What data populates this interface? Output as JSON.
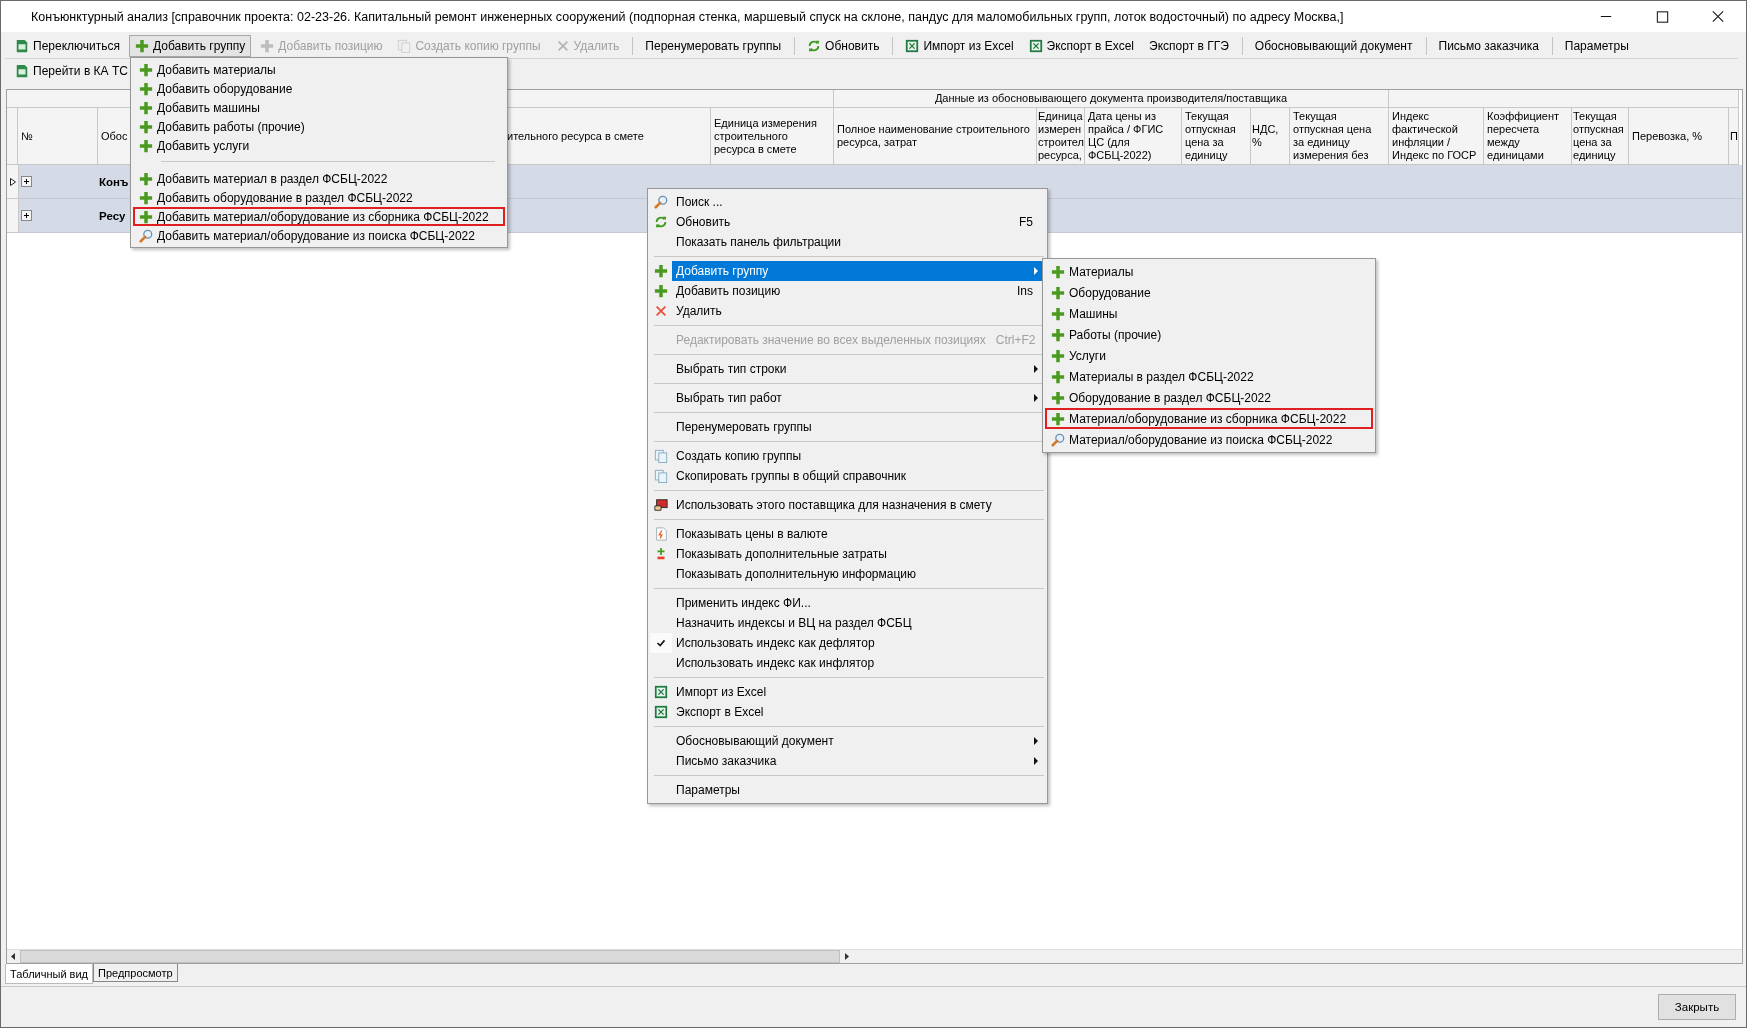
{
  "window": {
    "title": "Конъюнктурный анализ [справочник проекта: 02-23-26. Капитальный ремонт инженерных сооружений (подпорная стенка, маршевый спуск на склоне, пандус для маломобильных групп, лоток водосточный) по адресу Москва,]"
  },
  "toolbar": [
    {
      "kind": "button",
      "label": "Переключиться",
      "disabled": false,
      "pressed": false
    },
    {
      "kind": "button",
      "label": "Добавить группу",
      "disabled": false,
      "pressed": true
    },
    {
      "kind": "button",
      "label": "Добавить позицию",
      "disabled": true,
      "pressed": false
    },
    {
      "kind": "button",
      "label": "Создать копию группы",
      "disabled": true,
      "pressed": false
    },
    {
      "kind": "button",
      "label": "Удалить",
      "disabled": true,
      "pressed": false
    },
    {
      "kind": "separator"
    },
    {
      "kind": "button",
      "label": "Перенумеровать группы",
      "disabled": false,
      "pressed": false
    },
    {
      "kind": "separator"
    },
    {
      "kind": "button",
      "label": "Обновить",
      "disabled": false,
      "pressed": false
    },
    {
      "kind": "separator"
    },
    {
      "kind": "button",
      "label": "Импорт из Excel",
      "disabled": false,
      "pressed": false
    },
    {
      "kind": "button",
      "label": "Экспорт в Excel",
      "disabled": false,
      "pressed": false
    },
    {
      "kind": "button",
      "label": "Экспорт в ГГЭ",
      "disabled": false,
      "pressed": false
    },
    {
      "kind": "separator"
    },
    {
      "kind": "button",
      "label": "Обосновывающий документ",
      "disabled": false,
      "pressed": false
    },
    {
      "kind": "separator"
    },
    {
      "kind": "button",
      "label": "Письмо заказчика",
      "disabled": false,
      "pressed": false
    },
    {
      "kind": "separator"
    },
    {
      "kind": "button",
      "label": "Параметры",
      "disabled": false,
      "pressed": false
    }
  ],
  "toolbar_2": [
    {
      "label": "Перейти в КА ТС"
    }
  ],
  "table": {
    "group_header": "Данные из обосновывающего документа производителя/поставщика",
    "columns": [
      {
        "label": "№"
      },
      {
        "label": "Обос"
      },
      {
        "label": "ительного ресурса в смете"
      },
      {
        "label": "Единица измерения строительного ресурса в смете"
      },
      {
        "label": "Полное наименование строительного ресурса, затрат"
      },
      {
        "label": "Единица измерен строител ресурса,"
      },
      {
        "label": "Дата цены из прайса / ФГИС ЦС (для ФСБЦ-2022)"
      },
      {
        "label": "Текущая отпускная цена за единицу"
      },
      {
        "label": "НДС, %"
      },
      {
        "label": "Текущая отпускная цена за единицу измерения без"
      },
      {
        "label": "Индекс фактической инфляции / Индекс по  ГОСР"
      },
      {
        "label": "Коэффициент пересчета между единицами"
      },
      {
        "label": "Текущая отпускная цена за единицу"
      },
      {
        "label": "Перевозка, %"
      },
      {
        "label": "П"
      }
    ],
    "rows": [
      {
        "label": "Конъ",
        "selected": true
      },
      {
        "label": "Ресу",
        "selected": false
      }
    ]
  },
  "dropdown": {
    "items": [
      {
        "kind": "item",
        "label": "Добавить материалы",
        "highlighted": false
      },
      {
        "kind": "item",
        "label": "Добавить оборудование",
        "highlighted": false
      },
      {
        "kind": "item",
        "label": "Добавить машины",
        "highlighted": false
      },
      {
        "kind": "item",
        "label": "Добавить работы (прочие)",
        "highlighted": false
      },
      {
        "kind": "item",
        "label": "Добавить услуги",
        "highlighted": false
      },
      {
        "kind": "separator"
      },
      {
        "kind": "item",
        "label": "Добавить материал в раздел ФСБЦ-2022",
        "highlighted": false
      },
      {
        "kind": "item",
        "label": "Добавить оборудование в раздел ФСБЦ-2022",
        "highlighted": false
      },
      {
        "kind": "item",
        "label": "Добавить материал/оборудование из сборника ФСБЦ-2022",
        "highlighted": true
      },
      {
        "kind": "item",
        "label": "Добавить материал/оборудование из поиска ФСБЦ-2022",
        "highlighted": false
      }
    ]
  },
  "context_menu": {
    "items": [
      {
        "kind": "item",
        "label": "Поиск ...",
        "selected": false,
        "disabled": false,
        "checked": false,
        "submenu": false
      },
      {
        "kind": "item",
        "label": "Обновить",
        "shortcut": "F5",
        "selected": false,
        "disabled": false,
        "checked": false,
        "submenu": false
      },
      {
        "kind": "item",
        "label": "Показать панель фильтрации",
        "selected": false,
        "disabled": false,
        "checked": false,
        "submenu": false
      },
      {
        "kind": "separator"
      },
      {
        "kind": "item",
        "label": "Добавить группу",
        "selected": true,
        "disabled": false,
        "checked": false,
        "submenu": true
      },
      {
        "kind": "item",
        "label": "Добавить позицию",
        "shortcut": "Ins",
        "selected": false,
        "disabled": false,
        "checked": false,
        "submenu": false
      },
      {
        "kind": "item",
        "label": "Удалить",
        "selected": false,
        "disabled": false,
        "checked": false,
        "submenu": false
      },
      {
        "kind": "separator"
      },
      {
        "kind": "item",
        "label": "Редактировать значение во всех выделенных позициях",
        "shortcut": "Ctrl+F2",
        "selected": false,
        "disabled": true,
        "checked": false,
        "submenu": false
      },
      {
        "kind": "separator"
      },
      {
        "kind": "item",
        "label": "Выбрать тип строки",
        "selected": false,
        "disabled": false,
        "checked": false,
        "submenu": true
      },
      {
        "kind": "separator"
      },
      {
        "kind": "item",
        "label": "Выбрать тип работ",
        "selected": false,
        "disabled": false,
        "checked": false,
        "submenu": true
      },
      {
        "kind": "separator"
      },
      {
        "kind": "item",
        "label": "Перенумеровать группы",
        "selected": false,
        "disabled": false,
        "checked": false,
        "submenu": false
      },
      {
        "kind": "separator"
      },
      {
        "kind": "item",
        "label": "Создать копию группы",
        "selected": false,
        "disabled": false,
        "checked": false,
        "submenu": false
      },
      {
        "kind": "item",
        "label": "Скопировать группы в общий справочник",
        "selected": false,
        "disabled": false,
        "checked": false,
        "submenu": false
      },
      {
        "kind": "separator"
      },
      {
        "kind": "item",
        "label": "Использовать этого поставщика для назначения в смету",
        "selected": false,
        "disabled": false,
        "checked": false,
        "submenu": false
      },
      {
        "kind": "separator"
      },
      {
        "kind": "item",
        "label": "Показывать цены в валюте",
        "selected": false,
        "disabled": false,
        "checked": false,
        "submenu": false
      },
      {
        "kind": "item",
        "label": "Показывать дополнительные затраты",
        "selected": false,
        "disabled": false,
        "checked": false,
        "submenu": false
      },
      {
        "kind": "item",
        "label": "Показывать дополнительную информацию",
        "selected": false,
        "disabled": false,
        "checked": false,
        "submenu": false
      },
      {
        "kind": "separator"
      },
      {
        "kind": "item",
        "label": "Применить индекс ФИ...",
        "selected": false,
        "disabled": false,
        "checked": false,
        "submenu": false
      },
      {
        "kind": "item",
        "label": "Назначить индексы и ВЦ на раздел ФСБЦ",
        "selected": false,
        "disabled": false,
        "checked": false,
        "submenu": false
      },
      {
        "kind": "item",
        "label": "Использовать индекс как дефлятор",
        "selected": false,
        "disabled": false,
        "checked": true,
        "submenu": false
      },
      {
        "kind": "item",
        "label": "Использовать индекс как инфлятор",
        "selected": false,
        "disabled": false,
        "checked": false,
        "submenu": false
      },
      {
        "kind": "separator"
      },
      {
        "kind": "item",
        "label": "Импорт из Excel",
        "selected": false,
        "disabled": false,
        "checked": false,
        "submenu": false
      },
      {
        "kind": "item",
        "label": "Экспорт в Excel",
        "selected": false,
        "disabled": false,
        "checked": false,
        "submenu": false
      },
      {
        "kind": "separator"
      },
      {
        "kind": "item",
        "label": "Обосновывающий документ",
        "selected": false,
        "disabled": false,
        "checked": false,
        "submenu": true
      },
      {
        "kind": "item",
        "label": "Письмо заказчика",
        "selected": false,
        "disabled": false,
        "checked": false,
        "submenu": true
      },
      {
        "kind": "separator"
      },
      {
        "kind": "item",
        "label": "Параметры",
        "selected": false,
        "disabled": false,
        "checked": false,
        "submenu": false
      }
    ]
  },
  "submenu": {
    "items": [
      {
        "label": "Материалы",
        "highlighted": false
      },
      {
        "label": "Оборудование",
        "highlighted": false
      },
      {
        "label": "Машины",
        "highlighted": false
      },
      {
        "label": "Работы (прочие)",
        "highlighted": false
      },
      {
        "label": "Услуги",
        "highlighted": false
      },
      {
        "label": "Материалы в раздел ФСБЦ-2022",
        "highlighted": false
      },
      {
        "label": "Оборудование в раздел ФСБЦ-2022",
        "highlighted": false
      },
      {
        "label": "Материал/оборудование из сборника ФСБЦ-2022",
        "highlighted": true
      },
      {
        "label": "Материал/оборудование из поиска ФСБЦ-2022",
        "highlighted": false
      }
    ]
  },
  "tabs": [
    {
      "label": "Табличный вид",
      "selected": true
    },
    {
      "label": "Предпросмотр",
      "selected": false
    }
  ],
  "close_button": "Закрыть"
}
